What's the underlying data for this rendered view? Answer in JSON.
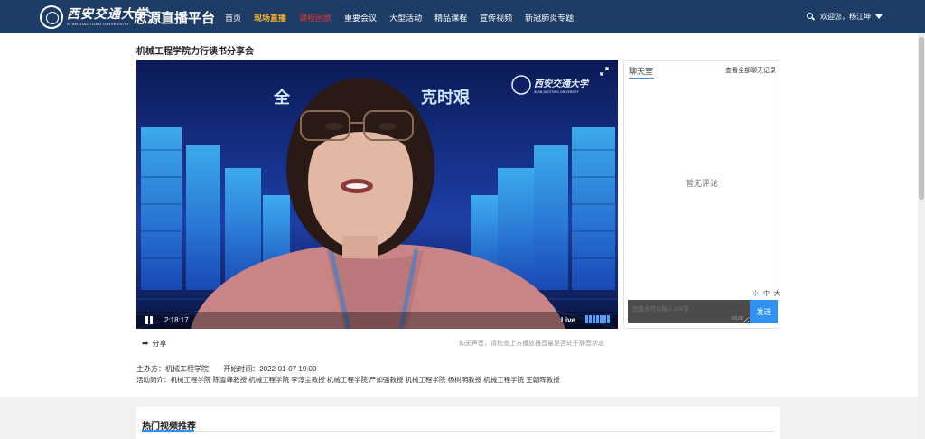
{
  "header": {
    "university_cn": "西安交通大学",
    "university_en": "XI'AN JIAOTONG UNIVERSITY",
    "platform_name": "思源直播平台",
    "nav": [
      "首页",
      "现场直播",
      "课程回放",
      "重要会议",
      "大型活动",
      "精品课程",
      "宣传视频",
      "新冠肺炎专题"
    ],
    "user_greeting": "欢迎您，杨江坤"
  },
  "page": {
    "title": "机械工程学院力行读书分享会"
  },
  "video": {
    "overlay_left": "全",
    "overlay_right": "克时艰",
    "watermark_cn": "西安交通大学",
    "watermark_en": "XI'AN JIAOTONG UNIVERSITY",
    "elapsed": "2:18:17",
    "live_label": "Live",
    "volume_level": 1
  },
  "actions": {
    "share_label": "分享",
    "audio_hint": "如无声音，请检查上方播放器音量是否处于静音状态"
  },
  "meta": {
    "host_label": "主办方：",
    "host_value": "机械工程学院",
    "start_label": "开始时间：",
    "start_value": "2022-01-07 19:00",
    "intro_label": "活动简介：",
    "intro_value": "机械工程学院 陈雪峰教授 机械工程学院 李淳尘教授 机械工程学院 严如强教授 机械工程学院 杨树明教授 机械工程学院 王朝晖教授"
  },
  "chat": {
    "tab_label": "聊天室",
    "all_records": "查看全部聊天记录",
    "empty_text": "暂无评论",
    "font_small": "小",
    "font_medium": "中",
    "font_large": "大",
    "input_placeholder": "您最多可以输入100字",
    "counter": "0/100",
    "send_label": "发送"
  },
  "hot": {
    "title": "热门视频推荐"
  },
  "colors": {
    "header_bg": "#1e3d66",
    "nav_active": "#f6b431",
    "nav_warn": "#e53935",
    "accent": "#2f92f2"
  }
}
